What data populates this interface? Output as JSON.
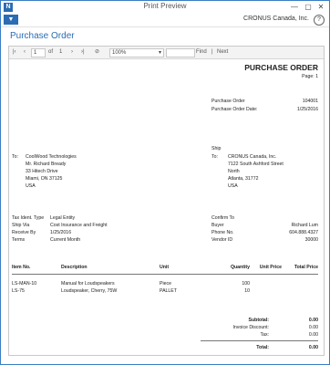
{
  "window": {
    "title": "Print Preview",
    "minimize": "—",
    "maximize": "▢",
    "close": "✕",
    "icon": "app-icon"
  },
  "menubar": {
    "company": "CRONUS Canada, Inc.",
    "help": "?",
    "menu_icon": "dropdown-icon"
  },
  "page_title": "Purchase Order",
  "toolbar": {
    "first": "|‹",
    "prev": "‹",
    "page": "1",
    "of_label": "of",
    "total_pages": "1",
    "next": "›",
    "last": "›|",
    "stop": "⊘",
    "zoom": "100%",
    "find": "Find",
    "sep": "|",
    "next_find": "Next"
  },
  "doc": {
    "heading": "PURCHASE ORDER",
    "page_label": "Page: 1",
    "po_label": "Purchase Order",
    "po_value": "104001",
    "date_label": "Purchase Order Date:",
    "date_value": "1/25/2016",
    "to_label": "To:",
    "vendor": [
      "CoolWood Technologies",
      "Mr. Richard Bready",
      "33 Hitech Drive",
      "Miami, ON  37125",
      "USA"
    ],
    "ship_label": "Ship",
    "ship_to_label": "To:",
    "ship_to": [
      "CRONUS Canada, Inc.",
      "7122 South Ashford Street",
      "North",
      "Atlanta, 31772",
      "USA"
    ],
    "left_info": [
      {
        "label": "Tax Ident. Type",
        "value": "Legal Entity"
      },
      {
        "label": "Ship Via",
        "value": "Cost Insurance and Freight"
      },
      {
        "label": "Receive By",
        "value": "1/25/2016"
      },
      {
        "label": "Terms",
        "value": "Current Month"
      }
    ],
    "right_info": [
      {
        "label": "Confirm To",
        "value": ""
      },
      {
        "label": "Buyer",
        "value": "Richard Lum"
      },
      {
        "label": "Phone No.",
        "value": "604.888.4327"
      },
      {
        "label": "Vendor ID",
        "value": "30000"
      }
    ],
    "columns": {
      "item": "Item No.",
      "desc": "Description",
      "unit": "Unit",
      "qty": "Quantity",
      "price": "Unit Price",
      "total": "Total Price"
    },
    "lines": [
      {
        "item": "LS-MAN-10",
        "desc": "Manual for Loudspeakers",
        "unit": "Piece",
        "qty": "100"
      },
      {
        "item": "LS-75",
        "desc": "Loudspeaker, Cherry, 75W",
        "unit": "PALLET",
        "qty": "10"
      }
    ],
    "totals": [
      {
        "label": "Subtotal:",
        "value": "0.00"
      },
      {
        "label": "Invoice Discount:",
        "value": "0.00"
      },
      {
        "label": "Tax:",
        "value": "0.00"
      }
    ],
    "grand_total_label": "Total:",
    "grand_total_value": "0.00"
  }
}
